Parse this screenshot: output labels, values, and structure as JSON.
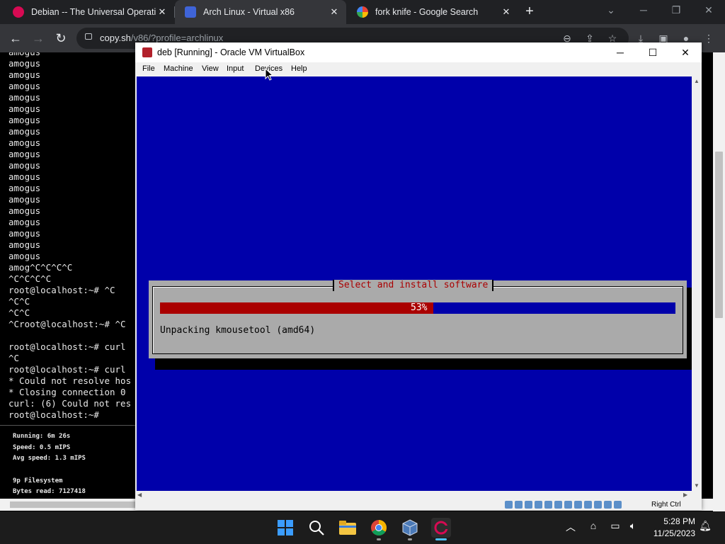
{
  "browser": {
    "tabs": [
      {
        "title": "Debian -- The Universal Operati",
        "favicon_color": "#d70a53"
      },
      {
        "title": "Arch Linux - Virtual x86",
        "favicon_color": "#3f64d8"
      },
      {
        "title": "fork knife - Google Search",
        "favicon_color": "#ffffff"
      }
    ],
    "new_tab_label": "+",
    "url_host": "copy.sh",
    "url_path": "/v86/?profile=archlinux"
  },
  "terminal": {
    "lines": [
      "amogus",
      "amogus",
      "amogus",
      "amogus",
      "amogus",
      "amogus",
      "amogus",
      "amogus",
      "amogus",
      "amogus",
      "amogus",
      "amogus",
      "amogus",
      "amogus",
      "amogus",
      "amogus",
      "amogus",
      "amogus",
      "amogus",
      "amog^C^C^C^C",
      "^C^C^C^C",
      "root@localhost:~# ^C",
      "^C^C",
      "^C^C",
      "^Croot@localhost:~# ^C",
      "",
      "root@localhost:~# curl",
      "^C",
      "root@localhost:~# curl",
      "* Could not resolve hos",
      "* Closing connection 0",
      "curl: (6) Could not res",
      "root@localhost:~#"
    ],
    "stats": {
      "running": "Running: 6m 26s",
      "speed": "Speed: 0.5 mIPS",
      "avg_speed": "Avg speed: 1.3 mIPS",
      "fs_title": "9p Filesystem",
      "bytes_read": "Bytes read: 7127418"
    }
  },
  "vbox": {
    "title": "deb [Running] - Oracle VM VirtualBox",
    "menu": [
      "File",
      "Machine",
      "View",
      "Input",
      "Devices",
      "Help"
    ],
    "host_key": "Right Ctrl",
    "installer": {
      "title": "Select and install software",
      "progress_percent": 53,
      "progress_label": "53%",
      "message": "Unpacking kmousetool (amd64)"
    },
    "colors": {
      "screen": "#0000aa",
      "progress_fill": "#aa0000",
      "dialog": "#aaaaaa"
    }
  },
  "taskbar": {
    "time": "5:28 PM",
    "date": "11/25/2023"
  }
}
